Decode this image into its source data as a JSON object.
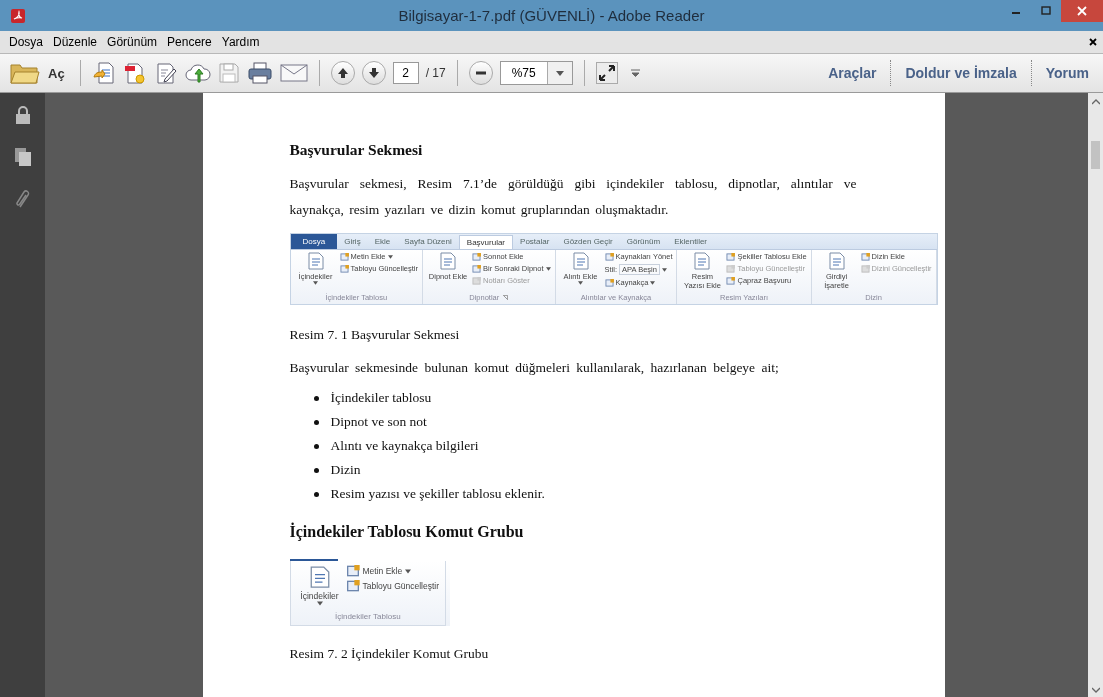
{
  "window": {
    "title": "Bilgisayar-1-7.pdf (GÜVENLİ) - Adobe Reader"
  },
  "menu": [
    "Dosya",
    "Düzenle",
    "Görünüm",
    "Pencere",
    "Yardım"
  ],
  "toolbar": {
    "open_label": "Aç",
    "page": "2",
    "page_total": "/ 17",
    "zoom": "%75",
    "panels": [
      "Araçlar",
      "Doldur ve İmzala",
      "Yorum"
    ]
  },
  "document": {
    "heading_1": "Başvurular Sekmesi",
    "paragraph_1": "Başvurular sekmesi, Resim 7.1’de görüldüğü gibi içindekiler tablosu, dipnotlar, alıntılar ve kaynakça, resim yazıları ve dizin komut gruplarından oluşmaktadır.",
    "figure_1": {
      "tabs": [
        {
          "label": "Dosya",
          "kind": "file",
          "selected": false
        },
        {
          "label": "Giriş",
          "kind": "tab",
          "selected": false
        },
        {
          "label": "Ekle",
          "kind": "tab",
          "selected": false
        },
        {
          "label": "Sayfa Düzeni",
          "kind": "tab",
          "selected": false
        },
        {
          "label": "Başvurular",
          "kind": "tab",
          "selected": true
        },
        {
          "label": "Postalar",
          "kind": "tab",
          "selected": false
        },
        {
          "label": "Gözden Geçir",
          "kind": "tab",
          "selected": false
        },
        {
          "label": "Görünüm",
          "kind": "tab",
          "selected": false
        },
        {
          "label": "Eklentiler",
          "kind": "tab",
          "selected": false
        }
      ],
      "groups": [
        {
          "label": "İçindekiler Tablosu",
          "launcher": false,
          "large": {
            "label": "İçindekiler",
            "dropdown": true
          },
          "items": [
            {
              "kind": "button",
              "label": "Metin Ekle",
              "dropdown": true,
              "disabled": false
            },
            {
              "kind": "button",
              "label": "Tabloyu Güncelleştir",
              "dropdown": false,
              "disabled": false
            }
          ]
        },
        {
          "label": "Dipnotlar",
          "launcher": true,
          "large": {
            "label": "Dipnot Ekle",
            "dropdown": false
          },
          "items": [
            {
              "kind": "button",
              "label": "Sonnot Ekle",
              "dropdown": false,
              "disabled": false
            },
            {
              "kind": "button",
              "label": "Bir Sonraki Dipnot",
              "dropdown": true,
              "disabled": false
            },
            {
              "kind": "button",
              "label": "Notları Göster",
              "dropdown": false,
              "disabled": true
            }
          ]
        },
        {
          "label": "Alıntılar ve Kaynakça",
          "launcher": false,
          "large": {
            "label": "Alıntı Ekle",
            "dropdown": true
          },
          "items": [
            {
              "kind": "button",
              "label": "Kaynakları Yönet",
              "dropdown": false,
              "disabled": false
            },
            {
              "kind": "select",
              "label": "Stil:",
              "value": "APA Beşin",
              "dropdown": true,
              "disabled": false
            },
            {
              "kind": "button",
              "label": "Kaynakça",
              "dropdown": true,
              "disabled": false
            }
          ]
        },
        {
          "label": "Resim Yazıları",
          "launcher": false,
          "large": {
            "label": "Resim Yazısı Ekle",
            "dropdown": false
          },
          "items": [
            {
              "kind": "button",
              "label": "Şekiller Tablosu Ekle",
              "dropdown": false,
              "disabled": false
            },
            {
              "kind": "button",
              "label": "Tabloyu Güncelleştir",
              "dropdown": false,
              "disabled": true
            },
            {
              "kind": "button",
              "label": "Çapraz Başvuru",
              "dropdown": false,
              "disabled": false
            }
          ]
        },
        {
          "label": "Dizin",
          "launcher": false,
          "large": {
            "label": "Girdiyi İşaretle",
            "dropdown": false
          },
          "items": [
            {
              "kind": "button",
              "label": "Dizin Ekle",
              "dropdown": false,
              "disabled": false
            },
            {
              "kind": "button",
              "label": "Dizini Güncelleştir",
              "dropdown": false,
              "disabled": true
            }
          ]
        }
      ]
    },
    "caption_1": "Resim 7. 1 Başvurular Sekmesi",
    "paragraph_2": "Başvurular sekmesinde bulunan komut düğmeleri kullanılarak, hazırlanan belgeye ait;",
    "bullets": [
      "İçindekiler tablosu",
      "Dipnot ve son not",
      "Alıntı ve kaynakça bilgileri",
      "Dizin",
      "Resim yazısı ve şekiller tablosu eklenir."
    ],
    "heading_2": "İçindekiler Tablosu Komut Grubu",
    "figure_2": {
      "groups": [
        {
          "label": "İçindekiler Tablosu",
          "launcher": false,
          "large": {
            "label": "İçindekiler",
            "dropdown": true
          },
          "items": [
            {
              "kind": "button",
              "label": "Metin Ekle",
              "dropdown": true,
              "disabled": false
            },
            {
              "kind": "button",
              "label": "Tabloyu Güncelleştir",
              "dropdown": false,
              "disabled": false
            }
          ]
        }
      ]
    },
    "caption_2": "Resim 7. 2 İçindekiler Komut Grubu"
  }
}
